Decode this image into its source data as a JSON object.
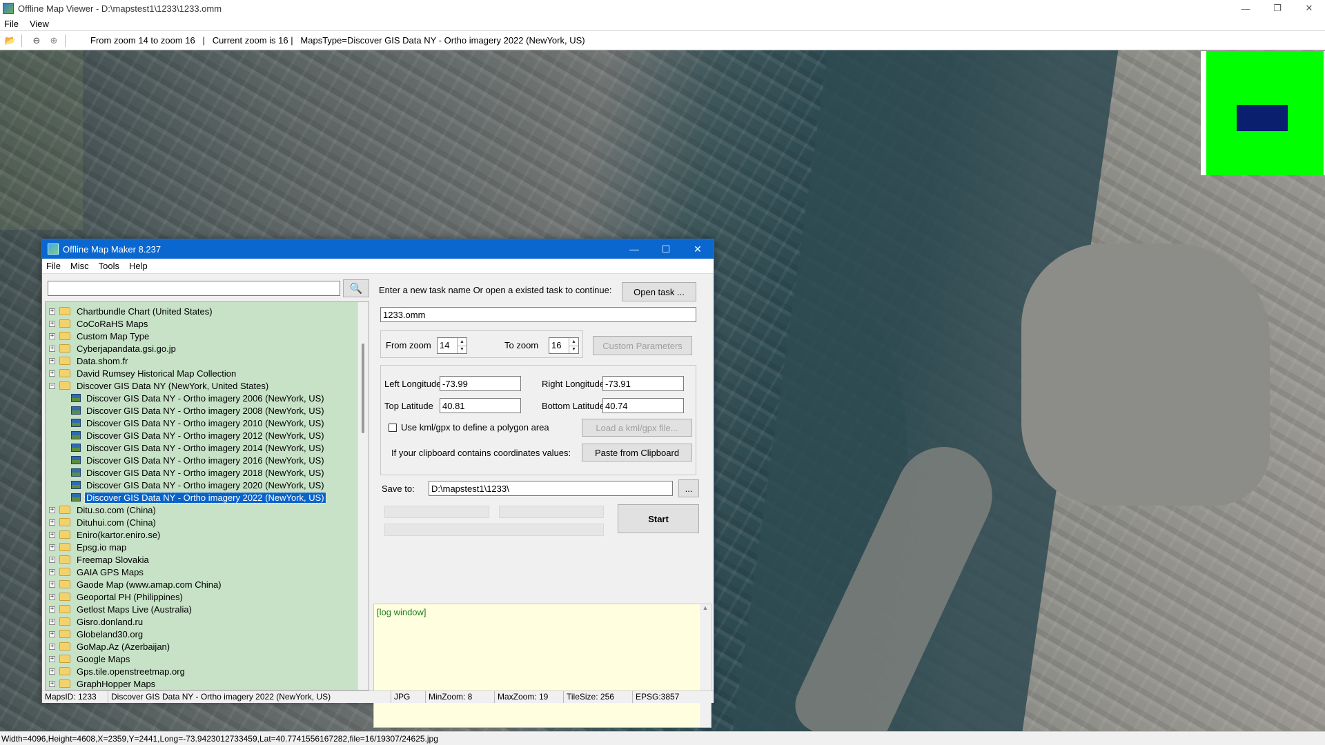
{
  "window": {
    "title": "Offline Map Viewer - D:\\mapstest1\\1233\\1233.omm",
    "controls": {
      "minimize": "—",
      "maximize": "❐",
      "close": "✕"
    }
  },
  "menu": [
    "File",
    "View"
  ],
  "toolbar": {
    "info": "From zoom 14 to zoom 16   |   Current zoom is 16 |   MapsType=Discover GIS Data NY - Ortho imagery 2022 (NewYork, US)"
  },
  "status": "Width=4096,Height=4608,X=2359,Y=2441,Long=-73.9423012733459,Lat=40.7741556167282,file=16/19307/24625.jpg",
  "colors": {
    "minimap_bg": "#00ff00",
    "minimap_rect": "#0a1f6e",
    "tree_bg": "#c7e2c7",
    "log_bg": "#ffffe0",
    "title_blue": "#0b67d0"
  },
  "dialog": {
    "title": "Offline Map Maker 8.237",
    "controls": {
      "minimize": "—",
      "maximize": "☐",
      "close": "✕"
    },
    "menu": [
      "File",
      "Misc",
      "Tools",
      "Help"
    ],
    "search": {
      "value": "",
      "icon": "search-icon"
    },
    "tree": {
      "items": [
        {
          "label": "Chartbundle Chart (United States)",
          "expanded": false
        },
        {
          "label": "CoCoRaHS Maps",
          "expanded": false
        },
        {
          "label": "Custom Map Type",
          "expanded": false
        },
        {
          "label": "Cyberjapandata.gsi.go.jp",
          "expanded": false
        },
        {
          "label": "Data.shom.fr",
          "expanded": false
        },
        {
          "label": "David Rumsey Historical Map Collection",
          "expanded": false
        },
        {
          "label": "Discover GIS Data NY (NewYork, United States)",
          "expanded": true
        }
      ],
      "children": [
        "Discover GIS Data NY - Ortho imagery 2006 (NewYork, US)",
        "Discover GIS Data NY - Ortho imagery 2008 (NewYork, US)",
        "Discover GIS Data NY - Ortho imagery 2010 (NewYork, US)",
        "Discover GIS Data NY - Ortho imagery 2012 (NewYork, US)",
        "Discover GIS Data NY - Ortho imagery 2014 (NewYork, US)",
        "Discover GIS Data NY - Ortho imagery 2016 (NewYork, US)",
        "Discover GIS Data NY - Ortho imagery 2018 (NewYork, US)",
        "Discover GIS Data NY - Ortho imagery 2020 (NewYork, US)",
        "Discover GIS Data NY - Ortho imagery 2022 (NewYork, US)"
      ],
      "selected_child": 8,
      "after": [
        "Ditu.so.com (China)",
        "Dituhui.com (China)",
        "Eniro(kartor.eniro.se)",
        "Epsg.io map",
        "Freemap Slovakia",
        "GAIA GPS Maps",
        "Gaode Map (www.amap.com China)",
        "Geoportal PH (Philippines)",
        "Getlost Maps Live (Australia)",
        "Gisro.donland.ru",
        "Globeland30.org",
        "GoMap.Az (Azerbaijan)",
        "Google Maps",
        "Gps.tile.openstreetmap.org",
        "GraphHopper Maps"
      ]
    },
    "task": {
      "prompt": "Enter a new task name Or open a existed task to continue:",
      "open_button": "Open task ...",
      "name_value": "1233.omm"
    },
    "zoom": {
      "from_label": "From zoom",
      "from_value": "14",
      "to_label": "To zoom",
      "to_value": "16",
      "custom_button": "Custom Parameters"
    },
    "coords": {
      "left_lon_label": "Left Longitude",
      "left_lon": "-73.99",
      "right_lon_label": "Right Longitude",
      "right_lon": "-73.91",
      "top_lat_label": "Top Latitude",
      "top_lat": "40.81",
      "bottom_lat_label": "Bottom Latitude",
      "bottom_lat": "40.74",
      "kml_label": "Use kml/gpx to define a polygon area",
      "kml_button": "Load a kml/gpx file...",
      "clipboard_label": "If your clipboard contains coordinates values:",
      "clipboard_button": "Paste from Clipboard"
    },
    "save": {
      "label": "Save to:",
      "value": "D:\\mapstest1\\1233\\",
      "browse": "..."
    },
    "start_button": "Start",
    "log": "[log window]",
    "statusbar": {
      "maps_id": "MapsID: 1233",
      "name": "Discover GIS Data NY - Ortho imagery 2022 (NewYork, US)",
      "format": "JPG",
      "min_zoom": "MinZoom: 8",
      "max_zoom": "MaxZoom: 19",
      "tile_size": "TileSize: 256",
      "epsg": "EPSG:3857"
    }
  }
}
